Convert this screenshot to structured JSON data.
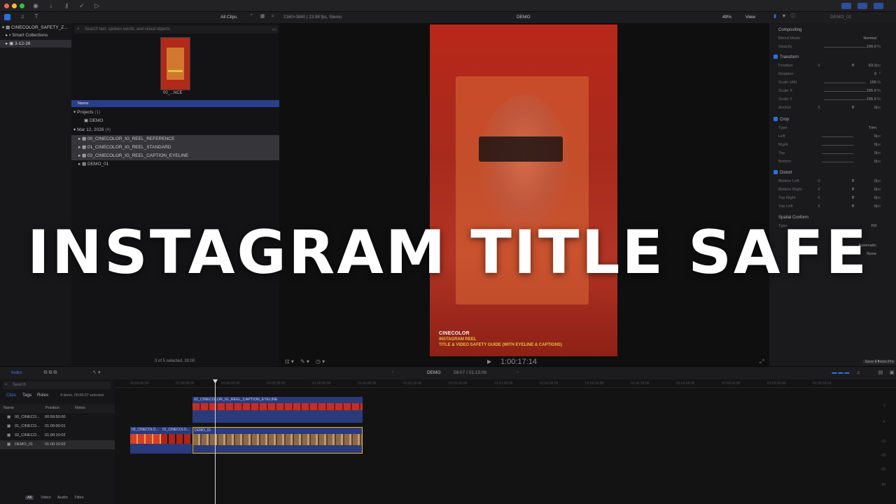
{
  "app": {
    "accent": "#2d6fe0",
    "overlay_title": "INSTAGRAM TITLE SAFE"
  },
  "toolbar": {
    "icons": [
      "import-icon",
      "download-icon",
      "key-icon",
      "check-icon",
      "share-icon"
    ],
    "right_icons": [
      "layout-icon",
      "layout-icon",
      "layout-icon"
    ]
  },
  "browser_bar": {
    "filter_label": "All Clips",
    "format": "2160×3840 | 23.98 fps, Stereo",
    "viewer_title": "DEMO",
    "zoom": "49%",
    "view_label": "View",
    "inspector_title": "DEMO_01"
  },
  "libraries": {
    "items": [
      {
        "label": "CINECOLOR_SAFETY_Z..."
      },
      {
        "label": "Smart Collections"
      },
      {
        "label": "3-12-26"
      }
    ]
  },
  "browser": {
    "search_placeholder": "Search text, spoken words, and visual objects",
    "thumb_label": "00_...NCE",
    "column_name": "Name",
    "projects_label": "Projects",
    "projects_count": "(1)",
    "project_item": "DEMO",
    "date_label": "Mar 12, 2026",
    "date_count": "(4)",
    "clips": [
      "00_CINECOLOR_IG_REEL_REFERENCE",
      "01_CINECOLOR_IG_REEL_STANDARD",
      "02_CINECOLOR_IG_REEL_CAPTION_EYELINE",
      "DEMO_01"
    ],
    "status": "3 of 5 selected, 30:00"
  },
  "viewer": {
    "timecode": "1:00:17:14",
    "caption_brand": "CINECOLOR",
    "caption_line1": "INSTAGRAM REEL",
    "caption_line2": "TITLE & VIDEO SAFETY GUIDE (WITH EYELINE & CAPTIONS)"
  },
  "inspector": {
    "compositing": "Compositing",
    "blend_mode_label": "Blend Mode",
    "blend_mode_value": "Normal",
    "opacity_label": "Opacity",
    "opacity_value": "100.0",
    "transform": "Transform",
    "position_label": "Position",
    "position_x": "0",
    "position_y": "63.2",
    "rotation_label": "Rotation",
    "rotation_value": "0",
    "scale_all_label": "Scale (All)",
    "scale_all_value": "155",
    "scale_x_label": "Scale X",
    "scale_x_value": "155.0",
    "scale_y_label": "Scale Y",
    "scale_y_value": "155.0",
    "anchor_label": "Anchor",
    "anchor_x": "0",
    "anchor_y": "0",
    "crop": "Crop",
    "type_label": "Type",
    "crop_type": "Trim",
    "left_label": "Left",
    "right_label": "Right",
    "top_label": "Top",
    "bottom_label": "Bottom",
    "zero": "0",
    "distort": "Distort",
    "bottom_left": "Bottom Left",
    "bottom_right": "Bottom Right",
    "top_right": "Top Right",
    "top_left": "Top Left",
    "spatial": "Spatial Conform",
    "spatial_type": "Fill",
    "auto_value": "Automatic",
    "none_value": "None",
    "px": "px",
    "pct": "%",
    "deg": "°",
    "x": "X",
    "y": "Y",
    "save_preset": "Save Effects Pre"
  },
  "timeline": {
    "index_label": "Index",
    "project_name": "DEMO",
    "duration": "56:07 / 01:15:09",
    "search_placeholder": "Search",
    "tabs": [
      "Clips",
      "Tags",
      "Roles"
    ],
    "selection_info": "4 items, 00:56:07 selected",
    "columns": [
      "Name",
      "Position",
      "Notes"
    ],
    "rows": [
      {
        "name": "00_CINECO...",
        "position": "00:59:50:00"
      },
      {
        "name": "01_CINECO...",
        "position": "01:00:00:01"
      },
      {
        "name": "02_CINECO...",
        "position": "01:00:10:02"
      },
      {
        "name": "DEMO_01",
        "position": "01:00:10:02"
      }
    ],
    "filters": [
      "All",
      "Video",
      "Audio",
      "Titles"
    ],
    "ticks": [
      "00:59:50:00",
      "01:00:05:00",
      "01:00:20:00",
      "01:00:35:00",
      "01:00:50:00",
      "01:01:05:00",
      "01:01:20:00",
      "01:01:35:00",
      "01:01:50:00",
      "01:02:05:00",
      "01:02:20:00",
      "01:02:35:00",
      "01:02:50:00",
      "01:03:05:00",
      "01:03:20:00",
      "01:03:35:00"
    ],
    "clip_top": "02_CINECOLOR_IG_REEL_CAPTION_EYELINE",
    "clip_a": "00_CINECOLO...",
    "clip_b": "01_CINECOLO...",
    "clip_main": "DEMO_01",
    "db_scale": [
      "0",
      "-6",
      "-12",
      "-20",
      "-30",
      "-50"
    ]
  }
}
